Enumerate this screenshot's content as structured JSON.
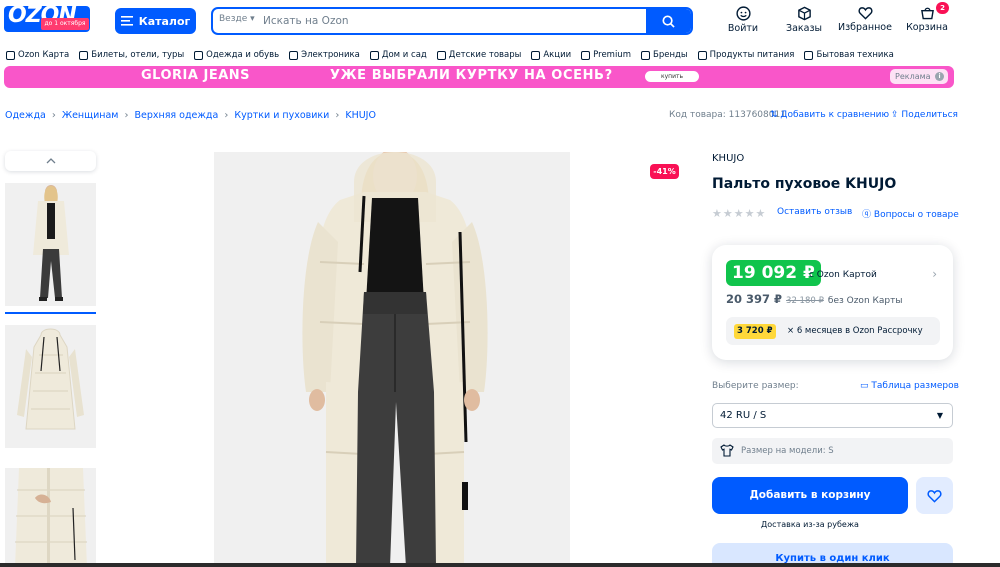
{
  "header": {
    "logo_text": "OZON",
    "logo_promo": "до 1 октября",
    "catalog_label": "Каталог",
    "search_scope": "Везде",
    "search_placeholder": "Искать на Ozon",
    "nav": [
      {
        "label": "Войти",
        "icon": "user-icon"
      },
      {
        "label": "Заказы",
        "icon": "box-icon"
      },
      {
        "label": "Избранное",
        "icon": "heart-icon"
      },
      {
        "label": "Корзина",
        "icon": "cart-icon",
        "badge": "2"
      }
    ]
  },
  "categories": [
    "Ozon Карта",
    "Билеты, отели, туры",
    "Одежда и обувь",
    "Электроника",
    "Дом и сад",
    "Детские товары",
    "Акции",
    "Premium",
    "Бренды",
    "Продукты питания",
    "Бытовая техника"
  ],
  "banner": {
    "brand": "GLORIA JEANS",
    "slogan": "УЖЕ ВЫБРАЛИ КУРТКУ НА ОСЕНЬ?",
    "button": "купить",
    "ad_label": "Реклама",
    "color": "#f956c9"
  },
  "breadcrumbs": [
    "Одежда",
    "Женщинам",
    "Верхняя одежда",
    "Куртки и пуховики",
    "KHUJO"
  ],
  "meta": {
    "sku": "Код товара: 1137608011",
    "compare": "Добавить к сравнению",
    "share": "Поделиться"
  },
  "gallery": {
    "discount_badge": "-41%"
  },
  "product": {
    "brand": "KHUJO",
    "title": "Пальто пуховое KHUJO",
    "rating": 0,
    "review_link": "Оставить отзыв",
    "qa_link": "Вопросы о товаре",
    "price_card": "19 092 ₽",
    "price_card_note": "с Ozon Картой",
    "price_regular": "20 397 ₽",
    "price_old": "32 180 ₽",
    "price_regular_note": "без Ozon Карты",
    "installment_amount": "3 720 ₽",
    "installment_text": "× 6 месяцев в Ozon Рассрочку",
    "size_label": "Выберите размер:",
    "size_table": "Таблица размеров",
    "size_selected": "42 RU / S",
    "model_size": "Размер на модели: S",
    "add_to_cart": "Добавить в корзину",
    "delivery": "Доставка из-за рубежа",
    "one_click": "Купить в один клик"
  },
  "colors": {
    "accent": "#005bff",
    "sale": "#f91155",
    "price_green": "#10c44c"
  }
}
